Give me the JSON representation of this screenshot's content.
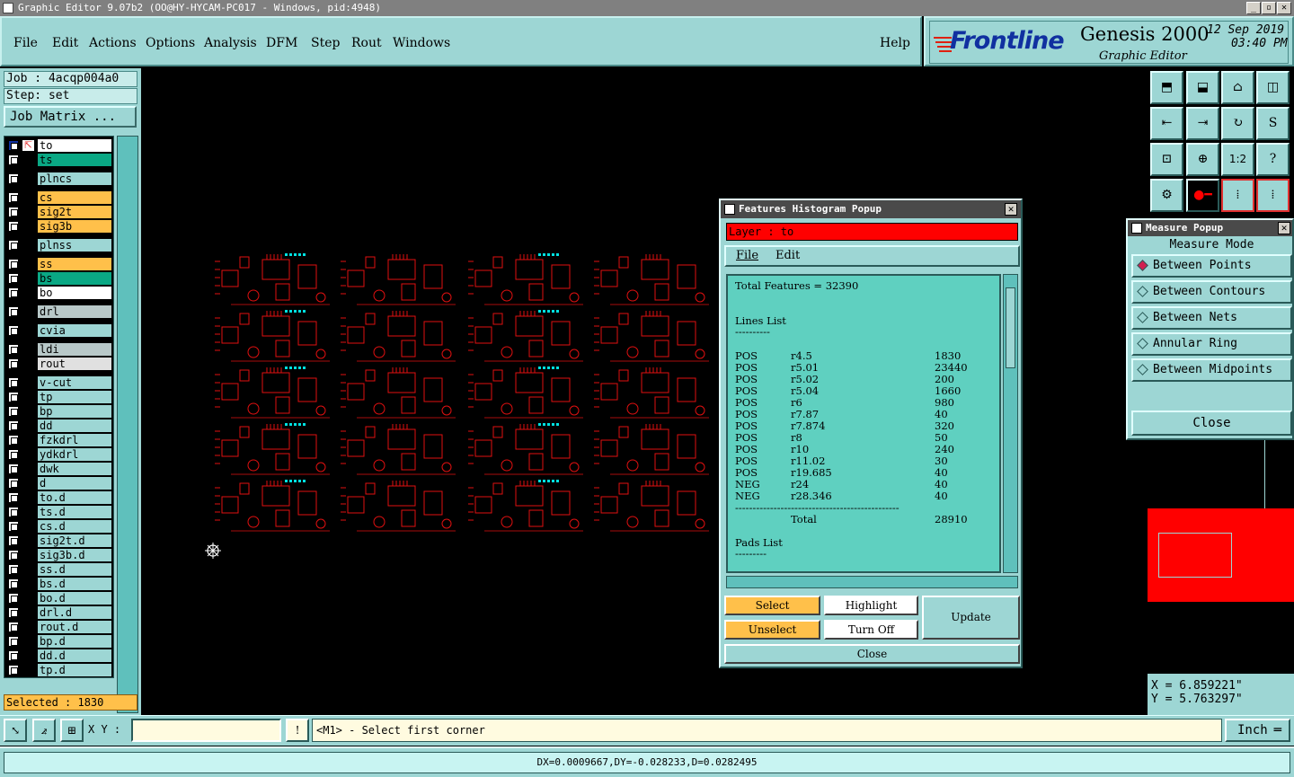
{
  "window": {
    "title": "Graphic Editor 9.07b2 (OO@HY-HYCAM-PC017 - Windows, pid:4948)"
  },
  "menubar": {
    "items": [
      "File",
      "Edit",
      "Actions",
      "Options",
      "Analysis",
      "DFM",
      "Step",
      "Rout",
      "Windows"
    ],
    "help": "Help"
  },
  "branding": {
    "logo": "Frontline",
    "product": "Genesis 2000",
    "subtitle": "Graphic Editor",
    "date": "12 Sep 2019",
    "time": "03:40 PM"
  },
  "job": {
    "job_label": "Job : 4acqp004a0",
    "step_label": "Step: set",
    "job_matrix": "Job Matrix ..."
  },
  "layers": [
    {
      "name": "to",
      "color": "#ffffff",
      "active": true
    },
    {
      "name": "ts",
      "color": "#0aa884"
    },
    {
      "name": "plncs",
      "color": "#9dd6d4"
    },
    {
      "name": "cs",
      "color": "#ffc04a"
    },
    {
      "name": "sig2t",
      "color": "#ffc04a"
    },
    {
      "name": "sig3b",
      "color": "#ffc04a"
    },
    {
      "name": "plnss",
      "color": "#9dd6d4"
    },
    {
      "name": "ss",
      "color": "#ffc04a"
    },
    {
      "name": "bs",
      "color": "#0aa884"
    },
    {
      "name": "bo",
      "color": "#ffffff"
    },
    {
      "name": "drl",
      "color": "#b8c8c8"
    },
    {
      "name": "cvia",
      "color": "#9dd6d4"
    },
    {
      "name": "ldi",
      "color": "#b8c8c8"
    },
    {
      "name": "rout",
      "color": "#e0e0e0"
    },
    {
      "name": "v-cut",
      "color": "#9dd6d4"
    },
    {
      "name": "tp",
      "color": "#9dd6d4"
    },
    {
      "name": "bp",
      "color": "#9dd6d4"
    },
    {
      "name": "dd",
      "color": "#9dd6d4"
    },
    {
      "name": "fzkdrl",
      "color": "#9dd6d4"
    },
    {
      "name": "ydkdrl",
      "color": "#9dd6d4"
    },
    {
      "name": "dwk",
      "color": "#9dd6d4"
    },
    {
      "name": "d",
      "color": "#9dd6d4"
    },
    {
      "name": "to.d",
      "color": "#9dd6d4"
    },
    {
      "name": "ts.d",
      "color": "#9dd6d4"
    },
    {
      "name": "cs.d",
      "color": "#9dd6d4"
    },
    {
      "name": "sig2t.d",
      "color": "#9dd6d4"
    },
    {
      "name": "sig3b.d",
      "color": "#9dd6d4"
    },
    {
      "name": "ss.d",
      "color": "#9dd6d4"
    },
    {
      "name": "bs.d",
      "color": "#9dd6d4"
    },
    {
      "name": "bo.d",
      "color": "#9dd6d4"
    },
    {
      "name": "drl.d",
      "color": "#9dd6d4"
    },
    {
      "name": "rout.d",
      "color": "#9dd6d4"
    },
    {
      "name": "bp.d",
      "color": "#9dd6d4"
    },
    {
      "name": "dd.d",
      "color": "#9dd6d4"
    },
    {
      "name": "tp.d",
      "color": "#9dd6d4"
    }
  ],
  "selected": "Selected : 1830",
  "features_popup": {
    "title": "Features Histogram Popup",
    "layer": "Layer :  to",
    "menu": [
      "File",
      "Edit"
    ],
    "total": "Total Features = 32390",
    "lines_header": "Lines List",
    "underline": "----------",
    "lines": [
      [
        "POS",
        "r4.5",
        "1830"
      ],
      [
        "POS",
        "r5.01",
        "23440"
      ],
      [
        "POS",
        "r5.02",
        "200"
      ],
      [
        "POS",
        "r5.04",
        "1660"
      ],
      [
        "POS",
        "r6",
        "980"
      ],
      [
        "POS",
        "r7.87",
        "40"
      ],
      [
        "POS",
        "r7.874",
        "320"
      ],
      [
        "POS",
        "r8",
        "50"
      ],
      [
        "POS",
        "r10",
        "240"
      ],
      [
        "POS",
        "r11.02",
        "30"
      ],
      [
        "POS",
        "r19.685",
        "40"
      ],
      [
        "NEG",
        "r24",
        "40"
      ],
      [
        "NEG",
        "r28.346",
        "40"
      ]
    ],
    "separator": "-----------------------------------------------",
    "total_label": "Total",
    "total_value": "28910",
    "pads_header": "Pads List",
    "pads_underline": "---------",
    "buttons": {
      "select": "Select",
      "highlight": "Highlight",
      "unselect": "Unselect",
      "turn_off": "Turn Off",
      "update": "Update",
      "close": "Close"
    }
  },
  "measure_popup": {
    "title": "Measure Popup",
    "mode_label": "Measure Mode",
    "options": [
      {
        "label": "Between Points",
        "selected": true
      },
      {
        "label": "Between Contours",
        "selected": false
      },
      {
        "label": "Between Nets",
        "selected": false
      },
      {
        "label": "Annular Ring",
        "selected": false
      },
      {
        "label": "Between Midpoints",
        "selected": false
      }
    ],
    "close": "Close"
  },
  "coords": {
    "x": "X  =  6.859221\"",
    "y": "Y  =  5.763297\""
  },
  "bottom": {
    "xy_label": "X Y :",
    "prompt": "<M1> - Select first corner",
    "unit": "Inch"
  },
  "status": "DX=0.0009667,DY=-0.028233,D=0.0282495",
  "colors": {
    "accent": "#9dd6d4",
    "layer_red": "#ff0000",
    "highlight": "#00e0e0"
  }
}
